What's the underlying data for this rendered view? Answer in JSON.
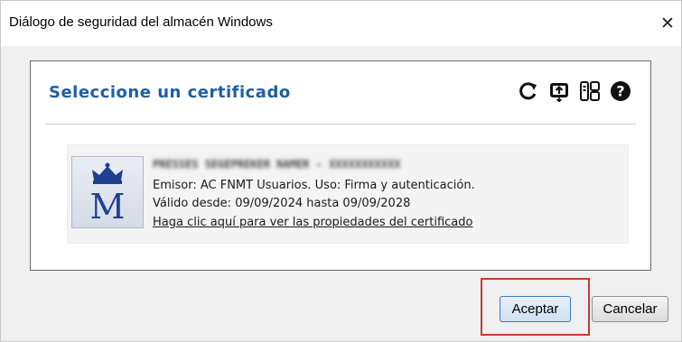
{
  "window": {
    "title": "Diálogo de seguridad del almacén Windows",
    "close_glyph": "✕"
  },
  "panel": {
    "heading": "Seleccione un certificado",
    "toolbar_icons": [
      "refresh-icon",
      "import-icon",
      "view-icon",
      "help-icon"
    ]
  },
  "certificate": {
    "subject_redacted": "PRESSES SEGEPREKER NAMER - XXXXXXXXXXX",
    "issuer_line": "Emisor: AC FNMT Usuarios. Uso: Firma y autenticación.",
    "validity_line": "Válido desde: 09/09/2024 hasta 09/09/2028",
    "properties_link": "Haga clic aquí para ver las propiedades del certificado",
    "logo_letter": "M",
    "logo_icon": "fnmt-crown-m-logo"
  },
  "buttons": {
    "accept_label": "Aceptar",
    "cancel_label": "Cancelar"
  },
  "colors": {
    "heading_blue": "#1d5ea8",
    "highlight_red": "#c43a3a"
  }
}
